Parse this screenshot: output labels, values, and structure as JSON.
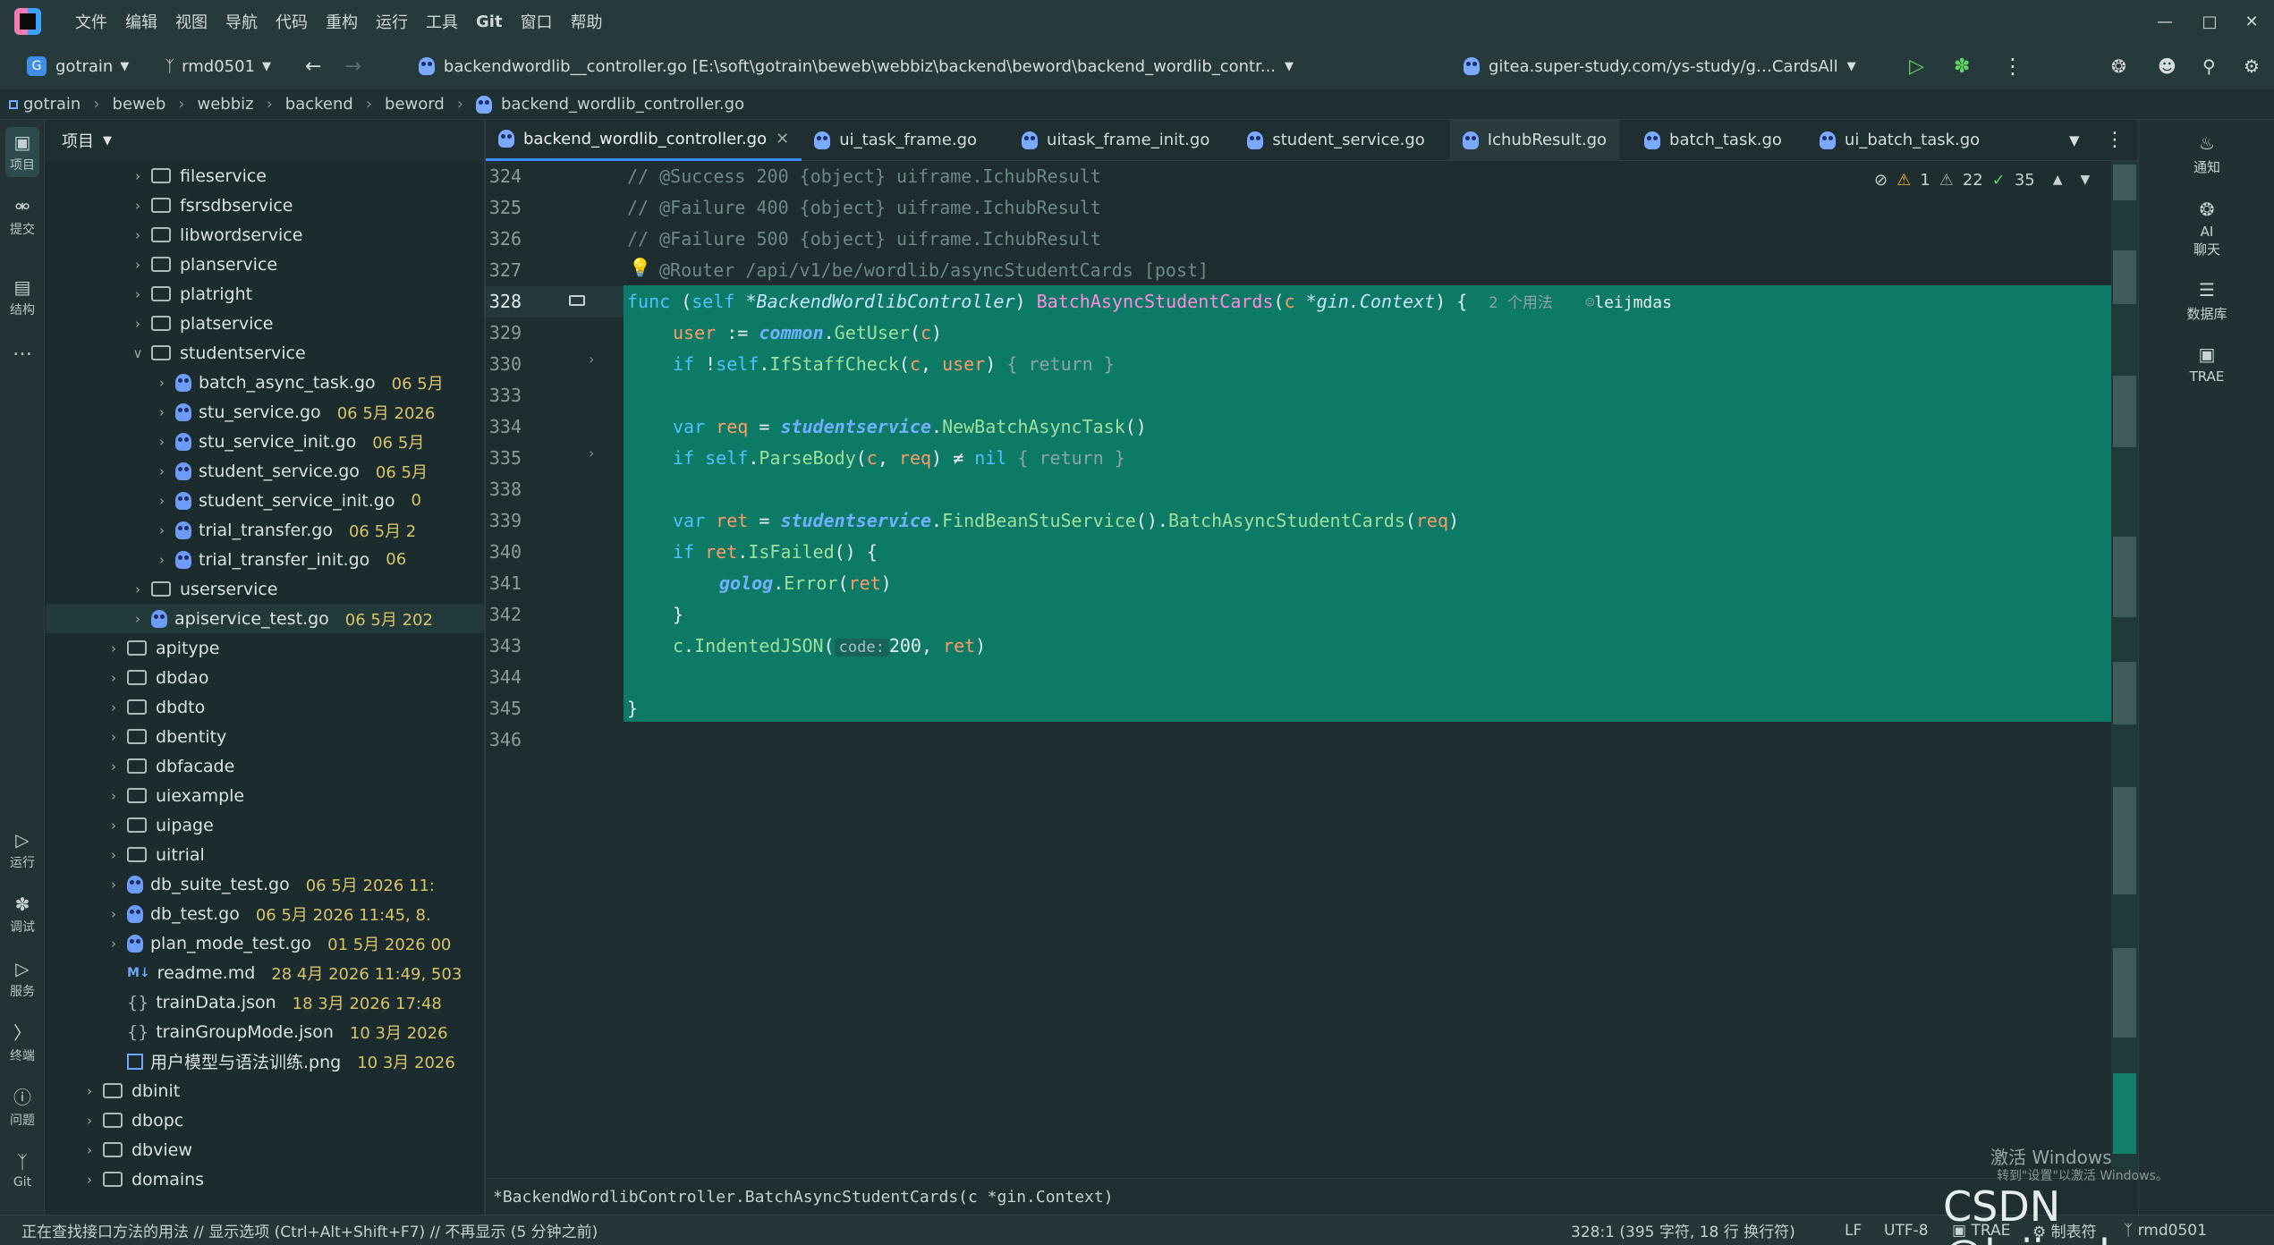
{
  "menu": [
    "文件",
    "编辑",
    "视图",
    "导航",
    "代码",
    "重构",
    "运行",
    "工具",
    "Git",
    "窗口",
    "帮助"
  ],
  "toolbar": {
    "project": "gotrain",
    "project_letter": "G",
    "branch": "rmd0501",
    "file_path": "backendwordlib__controller.go [E:\\soft\\gotrain\\beweb\\webbiz\\backend\\beword\\backend_wordlib_contr...",
    "run_config": "gitea.super-study.com/ys-study/g…CardsAll"
  },
  "breadcrumb": [
    "gotrain",
    "beweb",
    "webbiz",
    "backend",
    "beword",
    "backend_wordlib_controller.go"
  ],
  "left_strip": {
    "project": "项目",
    "commit": "提交",
    "structure": "结构",
    "more": "…",
    "run": "运行",
    "debug": "调试",
    "services": "服务",
    "terminal": "终端",
    "problems": "问题",
    "git": "Git"
  },
  "project_panel": {
    "title": "项目",
    "rows": [
      {
        "name": "fileservice",
        "type": "folder",
        "meta": ""
      },
      {
        "name": "fsrsdbservice",
        "type": "folder",
        "meta": ""
      },
      {
        "name": "libwordservice",
        "type": "folder",
        "meta": ""
      },
      {
        "name": "planservice",
        "type": "folder",
        "meta": ""
      },
      {
        "name": "platright",
        "type": "folder",
        "meta": ""
      },
      {
        "name": "platservice",
        "type": "folder",
        "meta": ""
      },
      {
        "name": "studentservice",
        "type": "folder",
        "meta": ""
      },
      {
        "name": "batch_async_task.go",
        "type": "go",
        "meta": "06 5月"
      },
      {
        "name": "stu_service.go",
        "type": "go",
        "meta": "06 5月 2026"
      },
      {
        "name": "stu_service_init.go",
        "type": "go",
        "meta": "06 5月"
      },
      {
        "name": "student_service.go",
        "type": "go",
        "meta": "06 5月"
      },
      {
        "name": "student_service_init.go",
        "type": "go",
        "meta": "0"
      },
      {
        "name": "trial_transfer.go",
        "type": "go",
        "meta": "06 5月 2"
      },
      {
        "name": "trial_transfer_init.go",
        "type": "go",
        "meta": "06"
      },
      {
        "name": "userservice",
        "type": "folder",
        "meta": ""
      },
      {
        "name": "apiservice_test.go",
        "type": "go",
        "meta": "06 5月 202"
      },
      {
        "name": "apitype",
        "type": "folder",
        "meta": ""
      },
      {
        "name": "dbdao",
        "type": "folder",
        "meta": ""
      },
      {
        "name": "dbdto",
        "type": "folder",
        "meta": ""
      },
      {
        "name": "dbentity",
        "type": "folder",
        "meta": ""
      },
      {
        "name": "dbfacade",
        "type": "folder",
        "meta": ""
      },
      {
        "name": "uiexample",
        "type": "folder",
        "meta": ""
      },
      {
        "name": "uipage",
        "type": "folder",
        "meta": ""
      },
      {
        "name": "uitrial",
        "type": "folder",
        "meta": ""
      },
      {
        "name": "db_suite_test.go",
        "type": "go",
        "meta": "06 5月 2026 11:"
      },
      {
        "name": "db_test.go",
        "type": "go",
        "meta": "06 5月 2026 11:45, 8."
      },
      {
        "name": "plan_mode_test.go",
        "type": "go",
        "meta": "01 5月 2026 00"
      },
      {
        "name": "readme.md",
        "type": "md",
        "meta": "28 4月 2026 11:49, 503"
      },
      {
        "name": "trainData.json",
        "type": "json",
        "meta": "18 3月 2026 17:48"
      },
      {
        "name": "trainGroupMode.json",
        "type": "json",
        "meta": "10 3月 2026"
      },
      {
        "name": "用户模型与语法训练.png",
        "type": "png",
        "meta": "10 3月 2026"
      },
      {
        "name": "dbinit",
        "type": "folder",
        "meta": ""
      },
      {
        "name": "dbopc",
        "type": "folder",
        "meta": ""
      },
      {
        "name": "dbview",
        "type": "folder",
        "meta": ""
      },
      {
        "name": "domains",
        "type": "folder",
        "meta": ""
      }
    ]
  },
  "tabs": [
    "backend_wordlib_controller.go",
    "ui_task_frame.go",
    "uitask_frame_init.go",
    "student_service.go",
    "IchubResult.go",
    "batch_task.go",
    "ui_batch_task.go"
  ],
  "inspections": {
    "warnings": "1",
    "weak": "22",
    "ok": "35"
  },
  "code": {
    "l324_n": "324",
    "l324": "// @Success 200 {object} uiframe.IchubResult",
    "l325_n": "325",
    "l325": "// @Failure 400 {object} uiframe.IchubResult",
    "l326_n": "326",
    "l326": "// @Failure 500 {object} uiframe.IchubResult",
    "l327_n": "327",
    "l327": "@Router /api/v1/be/wordlib/asyncStudentCards [post]",
    "l328_n": "328",
    "usages": "2 个用法",
    "author": "leijmdas",
    "l329_n": "329",
    "l330_n": "330",
    "l333_n": "333",
    "l334_n": "334",
    "l335_n": "335",
    "l338_n": "338",
    "l339_n": "339",
    "l340_n": "340",
    "l341_n": "341",
    "l342_n": "342",
    "l343_n": "343",
    "l344_n": "344",
    "l345_n": "345",
    "l346_n": "346",
    "hint_code": "code:"
  },
  "signature": "*BackendWordlibController.BatchAsyncStudentCards(c *gin.Context)",
  "right_strip": {
    "notifications": "通知",
    "ai": "AI\n聊天",
    "database": "数据库",
    "trae": "TRAE"
  },
  "status": {
    "message": "正在查找接口方法的用法 // 显示选项 (Ctrl+Alt+Shift+F7) // 不再显示 (5 分钟之前)",
    "position": "328:1 (395 字符, 18 行 换行符)",
    "line_sep": "LF",
    "encoding": "UTF-8",
    "trae": "TRAE",
    "table": "制表符",
    "branch": "rmd0501"
  },
  "overlay": {
    "activate_title": "激活 Windows",
    "activate_sub": "转到\"设置\"以激活 Windows。",
    "watermark": "CSDN @leijmdas"
  },
  "colors": {
    "selection": "#0d7a66",
    "accent": "#3b8bff",
    "keyword": "#4ec2ff",
    "function": "#ff8ae0"
  }
}
